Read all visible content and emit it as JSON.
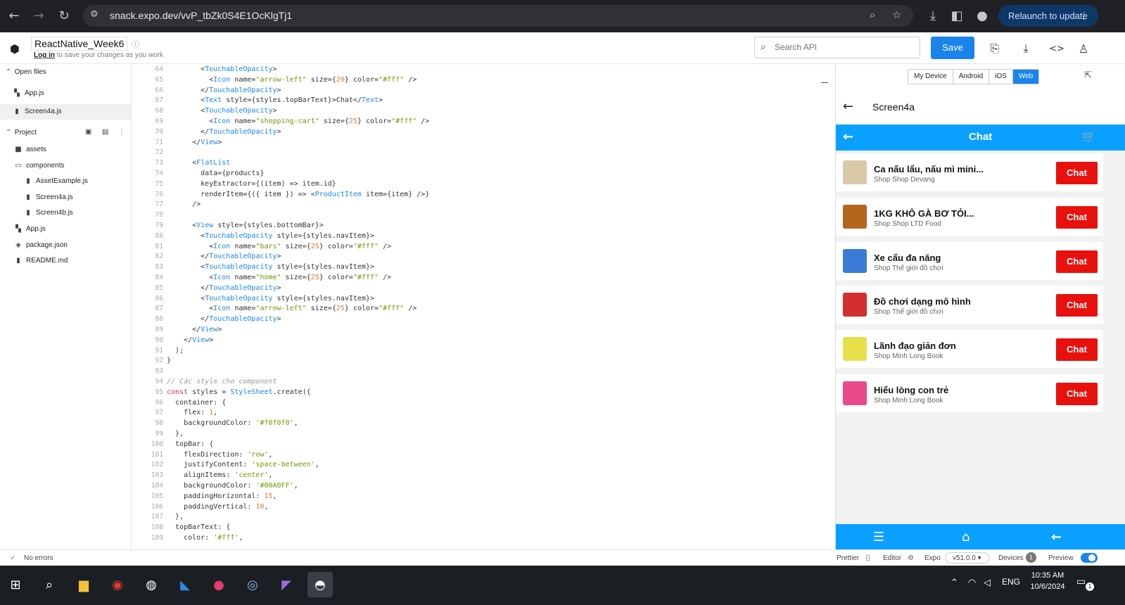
{
  "browser": {
    "url": "snack.expo.dev/vvP_tbZk0S4E1OcKlgTj1",
    "relaunch_label": "Relaunch to update"
  },
  "header": {
    "project_name": "ReactNative_Week6",
    "login_link": "Log in",
    "login_suffix": " to save your changes as you work",
    "search_placeholder": "Search API",
    "save_label": "Save"
  },
  "sidebar": {
    "open_files_label": "Open files",
    "open_files": [
      "App.js",
      "Screen4a.js"
    ],
    "project_label": "Project",
    "tree": [
      {
        "name": "assets",
        "icon": "folder-icon",
        "level": 0
      },
      {
        "name": "components",
        "icon": "folder-open-icon",
        "level": 0
      },
      {
        "name": "AssetExample.js",
        "icon": "file-icon",
        "level": 1
      },
      {
        "name": "Screen4a.js",
        "icon": "file-icon",
        "level": 1
      },
      {
        "name": "Screen4b.js",
        "icon": "file-icon",
        "level": 1
      },
      {
        "name": "App.js",
        "icon": "js-file-icon",
        "level": 0
      },
      {
        "name": "package.json",
        "icon": "package-icon",
        "level": 0
      },
      {
        "name": "README.md",
        "icon": "file-icon",
        "level": 0
      }
    ]
  },
  "editor": {
    "lines": [
      {
        "n": "64",
        "code": "        <TouchableOpacity>"
      },
      {
        "n": "65",
        "code": "          <Icon name=\"arrow-left\" size={20} color=\"#fff\" />"
      },
      {
        "n": "66",
        "code": "        </TouchableOpacity>"
      },
      {
        "n": "67",
        "code": "        <Text style={styles.topBarText}>Chat</Text>"
      },
      {
        "n": "68",
        "code": "        <TouchableOpacity>"
      },
      {
        "n": "69",
        "code": "          <Icon name=\"shopping-cart\" size={25} color=\"#fff\" />"
      },
      {
        "n": "70",
        "code": "        </TouchableOpacity>"
      },
      {
        "n": "71",
        "code": "      </View>"
      },
      {
        "n": "72",
        "code": ""
      },
      {
        "n": "73",
        "code": "      <FlatList"
      },
      {
        "n": "74",
        "code": "        data={products}"
      },
      {
        "n": "75",
        "code": "        keyExtractor={(item) => item.id}"
      },
      {
        "n": "76",
        "code": "        renderItem={({ item }) => <ProductItem item={item} />}"
      },
      {
        "n": "77",
        "code": "      />"
      },
      {
        "n": "78",
        "code": ""
      },
      {
        "n": "79",
        "code": "      <View style={styles.bottomBar}>"
      },
      {
        "n": "80",
        "code": "        <TouchableOpacity style={styles.navItem}>"
      },
      {
        "n": "81",
        "code": "          <Icon name=\"bars\" size={25} color=\"#fff\" />"
      },
      {
        "n": "82",
        "code": "        </TouchableOpacity>"
      },
      {
        "n": "83",
        "code": "        <TouchableOpacity style={styles.navItem}>"
      },
      {
        "n": "84",
        "code": "          <Icon name=\"home\" size={25} color=\"#fff\" />"
      },
      {
        "n": "85",
        "code": "        </TouchableOpacity>"
      },
      {
        "n": "86",
        "code": "        <TouchableOpacity style={styles.navItem}>"
      },
      {
        "n": "87",
        "code": "          <Icon name=\"arrow-left\" size={25} color=\"#fff\" />"
      },
      {
        "n": "88",
        "code": "        </TouchableOpacity>"
      },
      {
        "n": "89",
        "code": "      </View>"
      },
      {
        "n": "90",
        "code": "    </View>"
      },
      {
        "n": "91",
        "code": "  );"
      },
      {
        "n": "92",
        "code": "}"
      },
      {
        "n": "93",
        "code": ""
      },
      {
        "n": "94",
        "code": "// Các style cho component"
      },
      {
        "n": "95",
        "code": "const styles = StyleSheet.create({"
      },
      {
        "n": "96",
        "code": "  container: {"
      },
      {
        "n": "97",
        "code": "    flex: 1,"
      },
      {
        "n": "98",
        "code": "    backgroundColor: '#f0f0f0',"
      },
      {
        "n": "99",
        "code": "  },"
      },
      {
        "n": "100",
        "code": "  topBar: {"
      },
      {
        "n": "101",
        "code": "    flexDirection: 'row',"
      },
      {
        "n": "102",
        "code": "    justifyContent: 'space-between',"
      },
      {
        "n": "103",
        "code": "    alignItems: 'center',"
      },
      {
        "n": "104",
        "code": "    backgroundColor: '#00A0FF',"
      },
      {
        "n": "105",
        "code": "    paddingHorizontal: 15,"
      },
      {
        "n": "106",
        "code": "    paddingVertical: 10,"
      },
      {
        "n": "107",
        "code": "  },"
      },
      {
        "n": "108",
        "code": "  topBarText: {"
      },
      {
        "n": "109",
        "code": "    color: '#fff',"
      }
    ]
  },
  "device": {
    "tabs": [
      "My Device",
      "Android",
      "iOS",
      "Web"
    ],
    "active_tab": "Web",
    "screen_title": "Screen4a",
    "topbar_title": "Chat",
    "chat_label": "Chat",
    "products": [
      {
        "name": "Ca nấu lẩu, nấu mì mini...",
        "shop": "Shop Shop Devang",
        "thumb_color": "#d9c9a8"
      },
      {
        "name": "1KG KHÔ GÀ BƠ TỎI...",
        "shop": "Shop Shop LTD Food",
        "thumb_color": "#b5651d"
      },
      {
        "name": "Xe cẩu đa năng",
        "shop": "Shop Thế giới đồ chơi",
        "thumb_color": "#3a7bd5"
      },
      {
        "name": "Đồ chơi dạng mô hình",
        "shop": "Shop Thế giới đồ chơi",
        "thumb_color": "#d32f2f"
      },
      {
        "name": "Lãnh đạo giản đơn",
        "shop": "Shop Minh Long Book",
        "thumb_color": "#e8e04a"
      },
      {
        "name": "Hiểu lòng con trẻ",
        "shop": "Shop Minh Long Book",
        "thumb_color": "#e84a8a"
      }
    ]
  },
  "status": {
    "errors": "No errors",
    "prettier": "Prettier",
    "editor": "Editor",
    "expo": "Expo",
    "sdk": "v51.0.0",
    "devices": "Devices",
    "devices_count": "1",
    "preview": "Preview"
  },
  "taskbar": {
    "time": "10:35 AM",
    "date": "10/6/2024",
    "lang": "ENG",
    "notif_count": "1"
  },
  "colors": {
    "accent": "#1a84ec",
    "app_blue": "#0aa0ff",
    "chat_red": "#e8110e"
  }
}
